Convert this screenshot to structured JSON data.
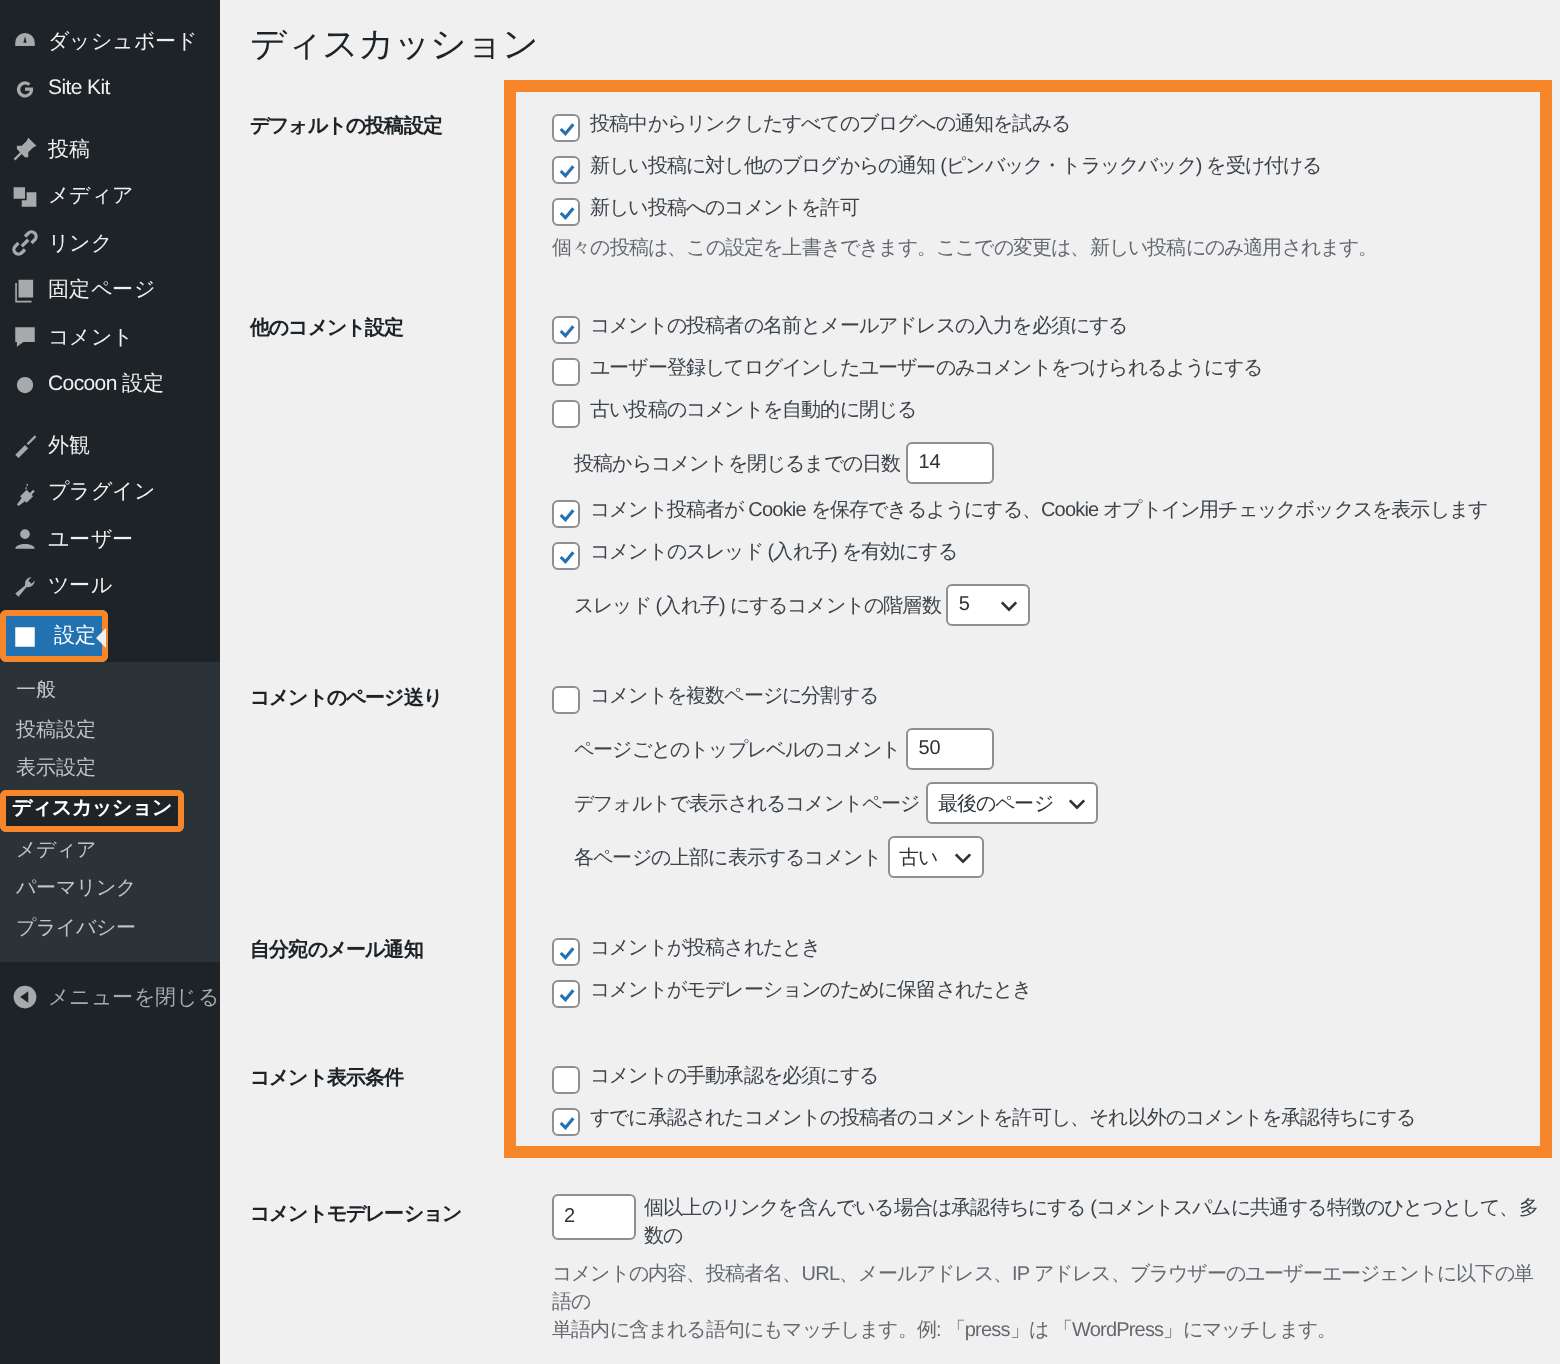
{
  "sidebar": {
    "groups": [
      {
        "items": [
          {
            "label": "ダッシュボード",
            "selected": false,
            "highlighted": false
          },
          {
            "label": "Site Kit",
            "selected": false,
            "highlighted": false
          }
        ]
      },
      {
        "items": [
          {
            "label": "投稿",
            "selected": false,
            "highlighted": false
          },
          {
            "label": "メディア",
            "selected": false,
            "highlighted": false
          },
          {
            "label": "リンク",
            "selected": false,
            "highlighted": false
          },
          {
            "label": "固定ページ",
            "selected": false,
            "highlighted": false
          },
          {
            "label": "コメント",
            "selected": false,
            "highlighted": false
          },
          {
            "label": "Cocoon 設定",
            "selected": false,
            "highlighted": false
          }
        ]
      },
      {
        "items": [
          {
            "label": "外観",
            "selected": false,
            "highlighted": false
          },
          {
            "label": "プラグイン",
            "selected": false,
            "highlighted": false
          },
          {
            "label": "ユーザー",
            "selected": false,
            "highlighted": false
          },
          {
            "label": "ツール",
            "selected": false,
            "highlighted": false
          },
          {
            "label": "設定",
            "selected": true,
            "highlighted": true,
            "children": [
              {
                "label": "一般",
                "selected": false,
                "highlighted": false
              },
              {
                "label": "投稿設定",
                "selected": false,
                "highlighted": false
              },
              {
                "label": "表示設定",
                "selected": false,
                "highlighted": false
              },
              {
                "label": "ディスカッション",
                "selected": true,
                "highlighted": true
              },
              {
                "label": "メディア",
                "selected": false,
                "highlighted": false
              },
              {
                "label": "パーマリンク",
                "selected": false,
                "highlighted": false
              },
              {
                "label": "プライバシー",
                "selected": false,
                "highlighted": false
              }
            ]
          }
        ]
      }
    ],
    "collapse": "メニューを閉じる"
  },
  "page_title": "ディスカッション",
  "sections": [
    {
      "label": "デフォルトの投稿設定",
      "highlighted": true,
      "fields": [
        {
          "kind": "checkbox",
          "text": "投稿中からリンクしたすべてのブログへの通知を試みる",
          "checked": true
        },
        {
          "kind": "checkbox",
          "text": "新しい投稿に対し他のブログからの通知 (ピンバック・トラックバック) を受け付ける",
          "checked": true
        },
        {
          "kind": "checkbox",
          "text": "新しい投稿へのコメントを許可",
          "checked": true
        },
        {
          "kind": "note",
          "text": "個々の投稿は、この設定を上書きできます。ここでの変更は、新しい投稿にのみ適用されます。"
        }
      ]
    },
    {
      "label": "他のコメント設定",
      "highlighted": true,
      "fields": [
        {
          "kind": "checkbox",
          "text": "コメントの投稿者の名前とメールアドレスの入力を必須にする",
          "checked": true
        },
        {
          "kind": "checkbox",
          "text": "ユーザー登録してログインしたユーザーのみコメントをつけられるようにする",
          "checked": false
        },
        {
          "kind": "checkbox",
          "text": "古い投稿のコメントを自動的に閉じる",
          "checked": false
        },
        {
          "kind": "number",
          "text": "投稿からコメントを閉じるまでの日数",
          "value": "14"
        },
        {
          "kind": "checkbox",
          "text": "コメント投稿者が Cookie を保存できるようにする、Cookie オプトイン用チェックボックスを表示します",
          "checked": true
        },
        {
          "kind": "checkbox",
          "text": "コメントのスレッド (入れ子) を有効にする",
          "checked": true
        },
        {
          "kind": "select",
          "text": "スレッド (入れ子) にするコメントの階層数",
          "value": "5"
        }
      ]
    },
    {
      "label": "コメントのページ送り",
      "highlighted": true,
      "fields": [
        {
          "kind": "checkbox",
          "text": "コメントを複数ページに分割する",
          "checked": false
        },
        {
          "kind": "number",
          "text": "ページごとのトップレベルのコメント",
          "value": "50"
        },
        {
          "kind": "select",
          "text": "デフォルトで表示されるコメントページ",
          "value": "最後のページ"
        },
        {
          "kind": "select",
          "text": "各ページの上部に表示するコメント",
          "value": "古い"
        }
      ]
    },
    {
      "label": "自分宛のメール通知",
      "highlighted": true,
      "fields": [
        {
          "kind": "checkbox",
          "text": "コメントが投稿されたとき",
          "checked": true
        },
        {
          "kind": "checkbox",
          "text": "コメントがモデレーションのために保留されたとき",
          "checked": true
        }
      ]
    },
    {
      "label": "コメント表示条件",
      "highlighted": true,
      "fields": [
        {
          "kind": "checkbox",
          "text": "コメントの手動承認を必須にする",
          "checked": false
        },
        {
          "kind": "checkbox",
          "text": "すでに承認されたコメントの投稿者のコメントを許可し、それ以外のコメントを承認待ちにする",
          "checked": true
        }
      ]
    },
    {
      "label": "コメントモデレーション",
      "highlighted": false,
      "fields": [
        {
          "kind": "number_first",
          "text": "個以上のリンクを含んでいる場合は承認待ちにする (コメントスパムに共通する特徴のひとつとして、多数の",
          "value": "2"
        },
        {
          "kind": "note",
          "text": "コメントの内容、投稿者名、URL、メールアドレス、IP アドレス、ブラウザーのユーザーエージェントに以下の単語の"
        },
        {
          "kind": "note",
          "text": "単語内に含まれる語句にもマッチします。例: 「press」は 「WordPress」にマッチします。"
        }
      ]
    }
  ]
}
